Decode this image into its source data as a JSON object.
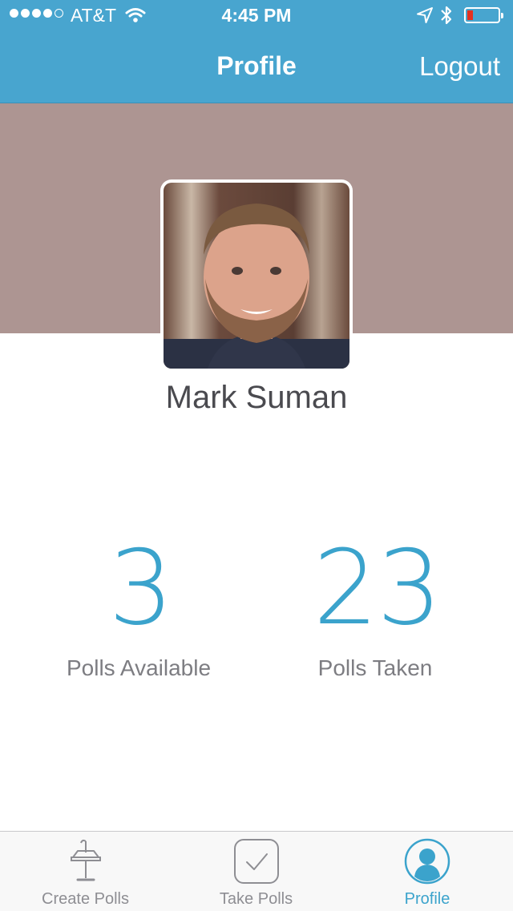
{
  "status_bar": {
    "carrier": "AT&T",
    "time": "4:45 PM",
    "signal_bars_filled": 4,
    "signal_bars_total": 5,
    "battery_level": 0.12,
    "icons": [
      "wifi-icon",
      "location-arrow-icon",
      "bluetooth-icon",
      "battery-icon"
    ]
  },
  "nav": {
    "title": "Profile",
    "logout_label": "Logout"
  },
  "profile": {
    "name": "Mark Suman"
  },
  "stats": {
    "available_value": "3",
    "available_label": "Polls Available",
    "taken_value": "23",
    "taken_label": "Polls Taken"
  },
  "tabs": [
    {
      "label": "Create Polls",
      "icon": "podium-icon"
    },
    {
      "label": "Take Polls",
      "icon": "checkbox-icon"
    },
    {
      "label": "Profile",
      "icon": "person-icon"
    }
  ],
  "colors": {
    "accent": "#48a5cf",
    "stat_blue": "#3ba3cc",
    "cover": "#ad9592",
    "battery_low": "#e5301f"
  }
}
